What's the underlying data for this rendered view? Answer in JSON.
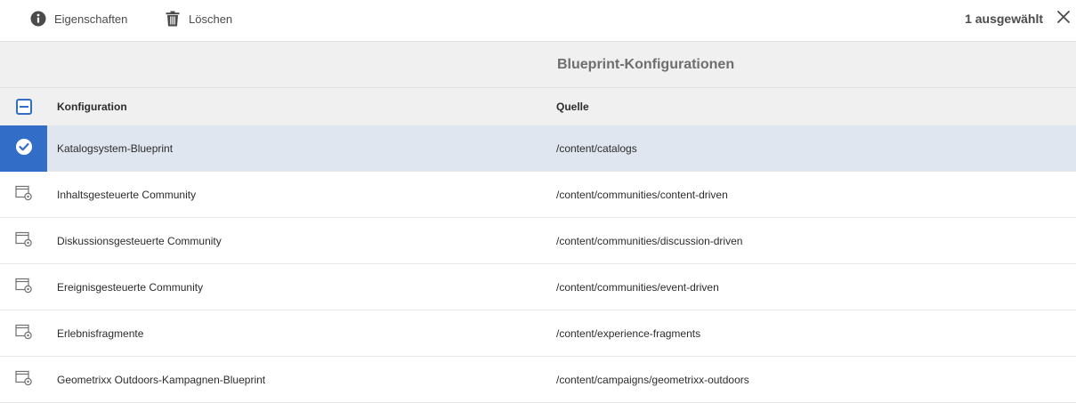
{
  "actionbar": {
    "properties_label": "Eigenschaften",
    "delete_label": "Löschen",
    "selection_count": "1 ausgewählt"
  },
  "page": {
    "title": "Blueprint-Konfigurationen"
  },
  "table": {
    "columns": [
      "Konfiguration",
      "Quelle"
    ],
    "rows": [
      {
        "name": "Katalogsystem-Blueprint",
        "source": "/content/catalogs",
        "selected": true
      },
      {
        "name": "Inhaltsgesteuerte Community",
        "source": "/content/communities/content-driven",
        "selected": false
      },
      {
        "name": "Diskussionsgesteuerte Community",
        "source": "/content/communities/discussion-driven",
        "selected": false
      },
      {
        "name": "Ereignisgesteuerte Community",
        "source": "/content/communities/event-driven",
        "selected": false
      },
      {
        "name": "Erlebnisfragmente",
        "source": "/content/experience-fragments",
        "selected": false
      },
      {
        "name": "Geometrixx Outdoors-Kampagnen-Blueprint",
        "source": "/content/campaigns/geometrixx-outdoors",
        "selected": false
      }
    ]
  },
  "icons": {
    "properties": "info-icon",
    "delete": "trash-icon",
    "close": "close-icon",
    "row_selected": "check-circle-icon",
    "row": "blueprint-config-icon"
  },
  "colors": {
    "accent": "#326ec8",
    "selected_row": "#dfe6ef",
    "header_bg": "#f0f0f0"
  }
}
